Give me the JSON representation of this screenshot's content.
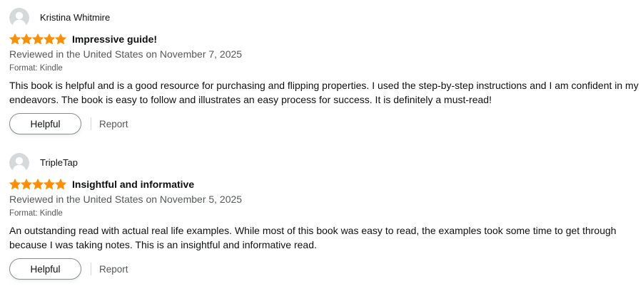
{
  "colors": {
    "star": "#ff8f00",
    "text": "#0f1111",
    "secondary_text": "#565959",
    "button_border": "#888c8c",
    "avatar_bg": "#d5d9d9",
    "avatar_fg": "#ffffff"
  },
  "reviews": [
    {
      "reviewer": "Kristina Whitmire",
      "rating": 5,
      "max_rating": 5,
      "title": "Impressive guide!",
      "date": "Reviewed in the United States on November 7, 2025",
      "format": "Format: Kindle",
      "body": "This book is helpful and is a good resource for purchasing and flipping properties. I used the step-by-step instructions and I am confident in my endeavors. The book is easy to follow and illustrates an easy process for success. It is definitely a must-read!",
      "helpful_label": "Helpful",
      "report_label": "Report"
    },
    {
      "reviewer": "TripleTap",
      "rating": 5,
      "max_rating": 5,
      "title": "Insightful and informative",
      "date": "Reviewed in the United States on November 5, 2025",
      "format": "Format: Kindle",
      "body": "An outstanding read with actual real life examples. While most of this book was easy to read, the examples took some time to get through because I was taking notes. This is an insightful and informative read.",
      "helpful_label": "Helpful",
      "report_label": "Report"
    }
  ]
}
